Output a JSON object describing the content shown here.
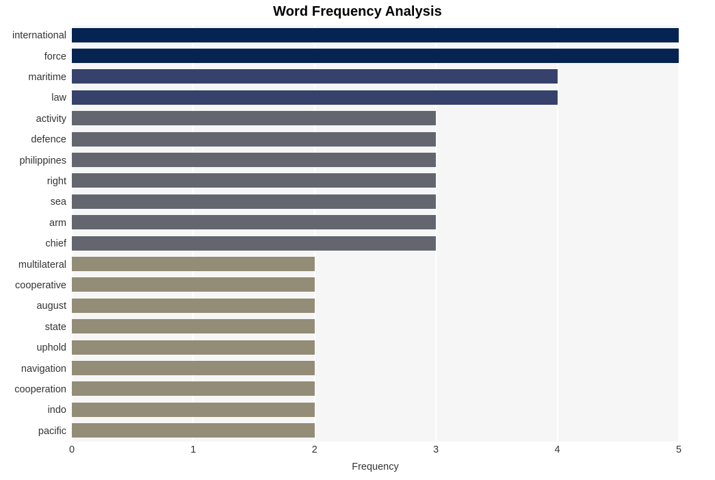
{
  "chart_data": {
    "type": "bar",
    "orientation": "horizontal",
    "title": "Word Frequency Analysis",
    "xlabel": "Frequency",
    "ylabel": "",
    "xlim": [
      0,
      5
    ],
    "xticks": [
      0,
      1,
      2,
      3,
      4,
      5
    ],
    "xtick_labels": [
      "0",
      "1",
      "2",
      "3",
      "4",
      "5"
    ],
    "grid": "vertical",
    "legend": "none",
    "categories": [
      "international",
      "force",
      "maritime",
      "law",
      "activity",
      "defence",
      "philippines",
      "right",
      "sea",
      "arm",
      "chief",
      "multilateral",
      "cooperative",
      "august",
      "state",
      "uphold",
      "navigation",
      "cooperation",
      "indo",
      "pacific"
    ],
    "values": [
      5,
      5,
      4,
      4,
      3,
      3,
      3,
      3,
      3,
      3,
      3,
      2,
      2,
      2,
      2,
      2,
      2,
      2,
      2,
      2
    ],
    "bar_colors": [
      "#052451",
      "#052451",
      "#36426b",
      "#36426b",
      "#63666f",
      "#63666f",
      "#63666f",
      "#63666f",
      "#63666f",
      "#63666f",
      "#63666f",
      "#938c76",
      "#938c76",
      "#938c76",
      "#938c76",
      "#938c76",
      "#938c76",
      "#938c76",
      "#938c76",
      "#938c76"
    ]
  },
  "style": {
    "plot_background": "#f6f6f7",
    "figure_background": "#ffffff",
    "gridline_color": "#ffffff",
    "text_color": "#333333",
    "title_color": "#000000"
  }
}
